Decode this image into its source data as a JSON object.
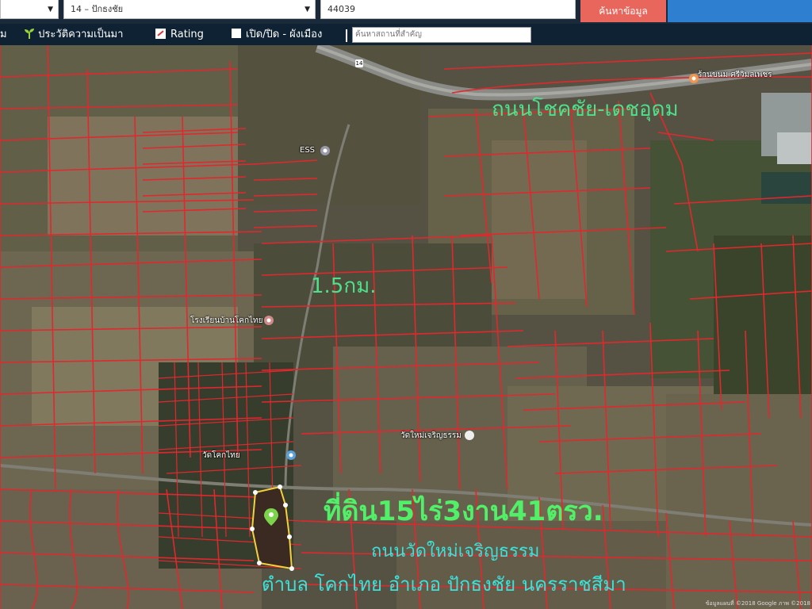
{
  "search": {
    "province_select": "",
    "district_select": "14 – ปักธงชัย",
    "postcode_value": "44039",
    "search_button": "ค้นหาข้อมูล"
  },
  "menu": {
    "item_partial": "ม",
    "history": "ประวัติความเป็นมา",
    "rating": "Rating",
    "zoning_toggle": "เปิด/ปิด - ผังเมือง",
    "place_search_placeholder": "ค้นหาสถานที่สำคัญ"
  },
  "map": {
    "road_main_label": "ถนนโชคชัย-เดชอุดม",
    "distance_label": "1.5กม.",
    "land_area_label": "ที่ดิน15ไร่3งาน41ตรว.",
    "road_local_label": "ถนนวัดใหม่เจริญธรรม",
    "location_label": "ตำบล โคกไทย อำเภอ ปักธงชัย นครราชสีมา",
    "route_number": "14",
    "attribution": "ข้อมูลแผนที่ ©2018 Google ภาพ ©2018",
    "poi": [
      {
        "label": "ESS"
      },
      {
        "label": "โรงเรียนบ้านโคกไทย"
      },
      {
        "label": "วัดใหม่เจริญธรรม"
      },
      {
        "label": "วัดโคกไทย"
      },
      {
        "label": "ร้านขนม ศรีวิมลเพชร"
      }
    ],
    "colors": {
      "parcel_lines": "#e0282e",
      "highlight_parcel": "#3a2a22",
      "highlight_border": "#f4d13c",
      "label_green": "#4ee08a",
      "label_cyan": "#3fe0d8"
    }
  }
}
